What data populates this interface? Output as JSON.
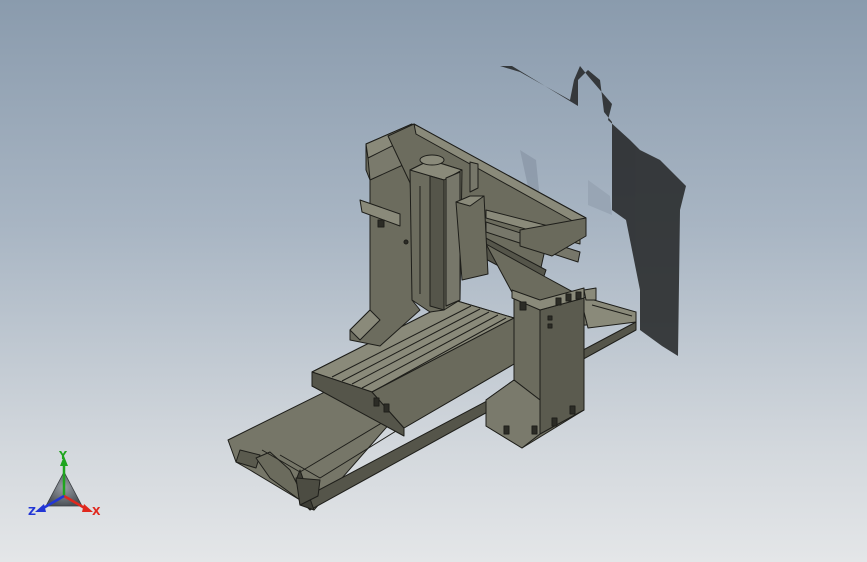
{
  "viewport": {
    "colors": {
      "machine_face": "#6c6c5e",
      "machine_top": "#8a8a7a",
      "machine_dark": "#4e4e44",
      "edge": "#1e1e1a",
      "shadow": "#2a2c2e"
    }
  },
  "triad": {
    "x_label": "X",
    "y_label": "Y",
    "z_label": "Z",
    "x_color": "#e0281e",
    "y_color": "#1fa51f",
    "z_color": "#2236d6"
  }
}
